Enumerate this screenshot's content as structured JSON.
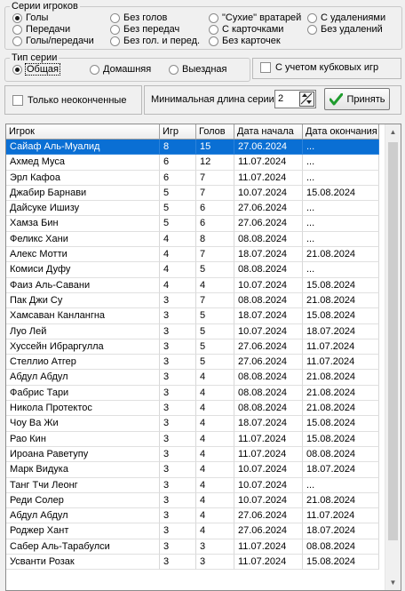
{
  "series_group": {
    "title": "Серии игроков",
    "options": [
      {
        "label": "Голы",
        "selected": true
      },
      {
        "label": "Передачи",
        "selected": false
      },
      {
        "label": "Голы/передачи",
        "selected": false
      },
      {
        "label": "Без голов",
        "selected": false
      },
      {
        "label": "Без передач",
        "selected": false
      },
      {
        "label": "Без гол. и перед.",
        "selected": false
      },
      {
        "label": "\"Сухие\" вратарей",
        "selected": false
      },
      {
        "label": "С карточками",
        "selected": false
      },
      {
        "label": "Без карточек",
        "selected": false
      },
      {
        "label": "С удалениями",
        "selected": false
      },
      {
        "label": "Без удалений",
        "selected": false
      }
    ]
  },
  "type_group": {
    "title": "Тип серии",
    "options": [
      {
        "label": "Общая",
        "selected": true
      },
      {
        "label": "Домашняя",
        "selected": false
      },
      {
        "label": "Выездная",
        "selected": false
      }
    ]
  },
  "cup_checkbox": {
    "label": "С учетом кубковых игр",
    "checked": false
  },
  "unfinished_checkbox": {
    "label": "Только неоконченные",
    "checked": false
  },
  "min_length": {
    "label": "Минимальная длина серии",
    "value": "2"
  },
  "accept_button": {
    "label": "Принять",
    "icon": "checkmark-icon",
    "icon_color": "#1f9c2e"
  },
  "grid": {
    "columns": [
      "Игрок",
      "Игр",
      "Голов",
      "Дата начала",
      "Дата окончания"
    ],
    "selected_color": "#0a6fd4",
    "rows": [
      [
        "Сайаф Аль-Муалид",
        "8",
        "15",
        "27.06.2024",
        "..."
      ],
      [
        "Ахмед Муса",
        "6",
        "12",
        "11.07.2024",
        "..."
      ],
      [
        "Эрл Кафоа",
        "6",
        "7",
        "11.07.2024",
        "..."
      ],
      [
        "Джабир Барнави",
        "5",
        "7",
        "10.07.2024",
        "15.08.2024"
      ],
      [
        "Дайсуке Ишизу",
        "5",
        "6",
        "27.06.2024",
        "..."
      ],
      [
        "Хамза Бин",
        "5",
        "6",
        "27.06.2024",
        "..."
      ],
      [
        "Феликс Хани",
        "4",
        "8",
        "08.08.2024",
        "..."
      ],
      [
        "Алекс Мотти",
        "4",
        "7",
        "18.07.2024",
        "21.08.2024"
      ],
      [
        "Комиси Дуфу",
        "4",
        "5",
        "08.08.2024",
        "..."
      ],
      [
        "Фаиз Аль-Савани",
        "4",
        "4",
        "10.07.2024",
        "15.08.2024"
      ],
      [
        "Пак Джи Су",
        "3",
        "7",
        "08.08.2024",
        "21.08.2024"
      ],
      [
        "Хамсаван Канлангна",
        "3",
        "5",
        "18.07.2024",
        "15.08.2024"
      ],
      [
        "Луо Лей",
        "3",
        "5",
        "10.07.2024",
        "18.07.2024"
      ],
      [
        "Хуссейн Ибраргулла",
        "3",
        "5",
        "27.06.2024",
        "11.07.2024"
      ],
      [
        "Стеллио Атгер",
        "3",
        "5",
        "27.06.2024",
        "11.07.2024"
      ],
      [
        "Абдул Абдул",
        "3",
        "4",
        "08.08.2024",
        "21.08.2024"
      ],
      [
        "Фабрис Тари",
        "3",
        "4",
        "08.08.2024",
        "21.08.2024"
      ],
      [
        "Никола Протектос",
        "3",
        "4",
        "08.08.2024",
        "21.08.2024"
      ],
      [
        "Чоу Ва Жи",
        "3",
        "4",
        "18.07.2024",
        "15.08.2024"
      ],
      [
        "Рао Кин",
        "3",
        "4",
        "11.07.2024",
        "15.08.2024"
      ],
      [
        "Ироана Раветупу",
        "3",
        "4",
        "11.07.2024",
        "08.08.2024"
      ],
      [
        "Марк Видука",
        "3",
        "4",
        "10.07.2024",
        "18.07.2024"
      ],
      [
        "Танг Тчи Леонг",
        "3",
        "4",
        "10.07.2024",
        "..."
      ],
      [
        "Реди Солер",
        "3",
        "4",
        "10.07.2024",
        "21.08.2024"
      ],
      [
        "Абдул Абдул",
        "3",
        "4",
        "27.06.2024",
        "11.07.2024"
      ],
      [
        "Роджер Хант",
        "3",
        "4",
        "27.06.2024",
        "18.07.2024"
      ],
      [
        "Сабер Аль-Тарабулси",
        "3",
        "3",
        "11.07.2024",
        "08.08.2024"
      ],
      [
        "Усванти Розак",
        "3",
        "3",
        "11.07.2024",
        "15.08.2024"
      ]
    ]
  }
}
